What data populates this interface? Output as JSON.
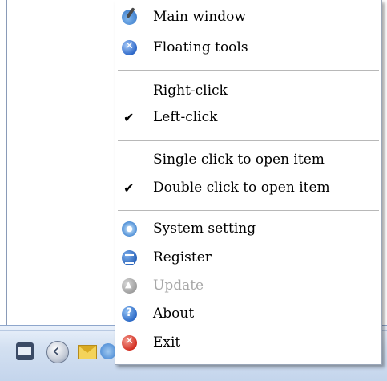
{
  "menu": {
    "items": [
      {
        "label": "Main window",
        "icon": "main-window-icon"
      },
      {
        "label": "Floating tools",
        "icon": "floating-tools-icon"
      },
      {
        "label": "Right-click",
        "checked": false
      },
      {
        "label": "Left-click",
        "checked": true
      },
      {
        "label": "Single click to open item",
        "checked": false
      },
      {
        "label": "Double click to open item",
        "checked": true
      },
      {
        "label": "System setting",
        "icon": "system-setting-icon"
      },
      {
        "label": "Register",
        "icon": "register-icon"
      },
      {
        "label": "Update",
        "icon": "update-icon",
        "disabled": true
      },
      {
        "label": "About",
        "icon": "about-icon"
      },
      {
        "label": "Exit",
        "icon": "exit-icon"
      }
    ],
    "check_glyph": "✔"
  },
  "taskbar": {
    "icons": [
      "keyboard-icon",
      "back-icon",
      "mail-icon",
      "tray-app-icon",
      "tray-misc-icon"
    ]
  }
}
